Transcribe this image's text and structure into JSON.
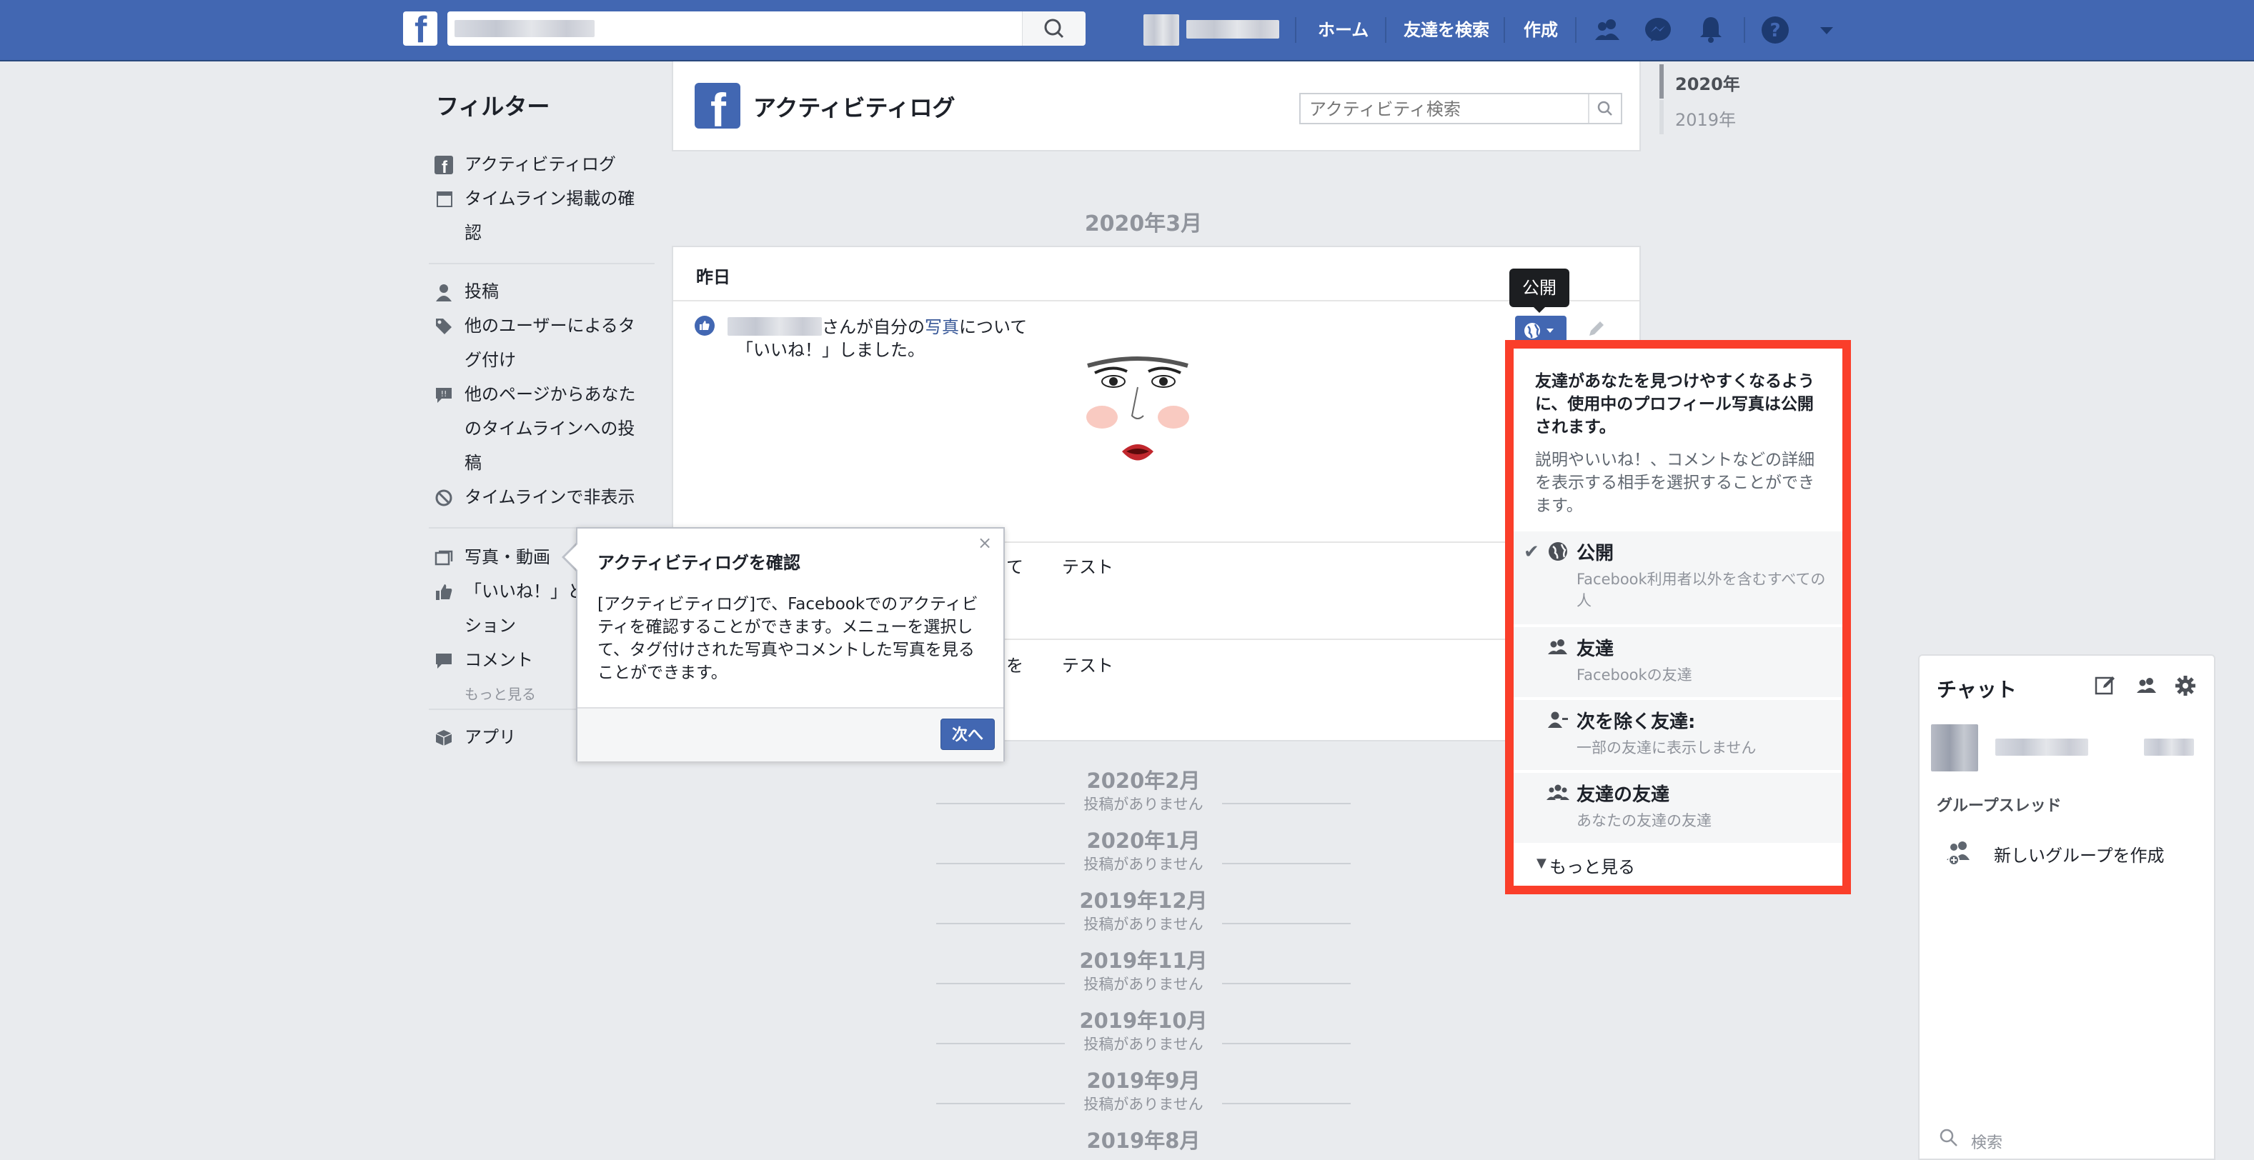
{
  "topbar": {
    "nav_links": [
      "ホーム",
      "友達を検索",
      "作成"
    ],
    "icons": [
      "friend-requests-icon",
      "messenger-icon",
      "notifications-icon",
      "help-icon",
      "account-menu-arrow-icon"
    ]
  },
  "sidebar": {
    "title": "フィルター",
    "items": [
      {
        "icon": "facebook-icon",
        "label": "アクティビティログ"
      },
      {
        "icon": "timeline-review-icon",
        "label": "タイムライン掲載の確\n認"
      },
      {
        "icon": "person-icon",
        "label": "投稿"
      },
      {
        "icon": "tag-icon",
        "label": "他のユーザーによるタ\nグ付け"
      },
      {
        "icon": "speech-bubble-icon",
        "label": "他のページからあなた\nのタイムラインへの投\n稿"
      },
      {
        "icon": "hidden-icon",
        "label": "タイムラインで非表示"
      },
      {
        "icon": "photos-icon",
        "label": "写真・動画"
      },
      {
        "icon": "like-icon",
        "label": "「いいね！」と\nション"
      },
      {
        "icon": "comment-icon",
        "label": "コメント"
      },
      {
        "icon": "",
        "label": "もっと見る"
      },
      {
        "icon": "apps-icon",
        "label": "アプリ"
      }
    ]
  },
  "header": {
    "title": "アクティビティログ",
    "search_placeholder": "アクティビティ検索"
  },
  "main": {
    "month": "2020年3月",
    "day_label": "昨日",
    "activity": {
      "text_after_name": "さんが自分の",
      "photo_link": "写真",
      "text_after_link": "について",
      "line2": "「いいね！」しました。"
    },
    "row2_fragment": "て",
    "row2_label": "テスト",
    "row3_fragment": "を",
    "row3_label": "テスト"
  },
  "privacy_tooltip": "公開",
  "privacy_dropdown": {
    "info_bold": "友達があなたを見つけやすくなるように、使用中のプロフィール写真は公開されます。",
    "info": "説明やいいね！、コメントなどの詳細を表示する相手を選択することができます。",
    "options": [
      {
        "icon": "globe-icon",
        "title": "公開",
        "desc": "Facebook利用者以外を含むすべての人",
        "selected": true
      },
      {
        "icon": "friends-icon",
        "title": "友達",
        "desc": "Facebookの友達",
        "selected": false
      },
      {
        "icon": "friends-except-icon",
        "title": "次を除く友達:",
        "desc": "一部の友達に表示しません",
        "selected": false
      },
      {
        "icon": "friends-of-friends-icon",
        "title": "友達の友達",
        "desc": "あなたの友達の友達",
        "selected": false
      }
    ],
    "more_label": "もっと見る"
  },
  "popover": {
    "title": "アクティビティログを確認",
    "close": "×",
    "body": "[アクティビティログ]で、Facebookでのアクティビティを確認することができます。メニューを選択して、タグ付けされた写真やコメントした写真を見ることができます。",
    "next_label": "次へ"
  },
  "past_months": [
    {
      "month": "2020年2月",
      "note": "投稿がありません"
    },
    {
      "month": "2020年1月",
      "note": "投稿がありません"
    },
    {
      "month": "2019年12月",
      "note": "投稿がありません"
    },
    {
      "month": "2019年11月",
      "note": "投稿がありません"
    },
    {
      "month": "2019年10月",
      "note": "投稿がありません"
    },
    {
      "month": "2019年9月",
      "note": "投稿がありません"
    },
    {
      "month": "2019年8月",
      "note": ""
    }
  ],
  "years": [
    "2020年",
    "2019年"
  ],
  "chat": {
    "title": "チャット",
    "group_heading": "グループスレッド",
    "new_group": "新しいグループを作成",
    "search_placeholder": "検索"
  },
  "colors": {
    "brand_blue": "#4267b2",
    "highlight_red": "#fa3e2a",
    "page_bg": "#e9ebee"
  }
}
